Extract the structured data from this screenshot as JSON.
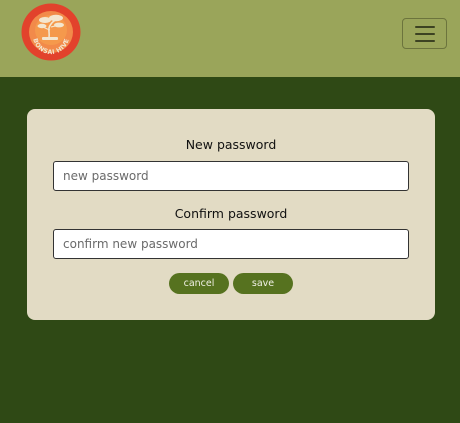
{
  "brand": {
    "logo_icon": "bonsai-tree-icon",
    "logo_text": "BONSAI HIVE",
    "colors": {
      "badge_outer": "#e2422c",
      "badge_inner": "#f7a64e",
      "tree": "#f4e6cf"
    }
  },
  "navbar": {
    "background": "#9aa55a",
    "toggle_icon": "hamburger-menu-icon"
  },
  "page": {
    "background": "#2f4915"
  },
  "form": {
    "new_password": {
      "label": "New password",
      "placeholder": "new password",
      "value": ""
    },
    "confirm_password": {
      "label": "Confirm password",
      "placeholder": "confirm new password",
      "value": ""
    },
    "cancel_label": "cancel",
    "save_label": "save",
    "button_color": "#56721f",
    "card_background": "#e2dbc4"
  }
}
